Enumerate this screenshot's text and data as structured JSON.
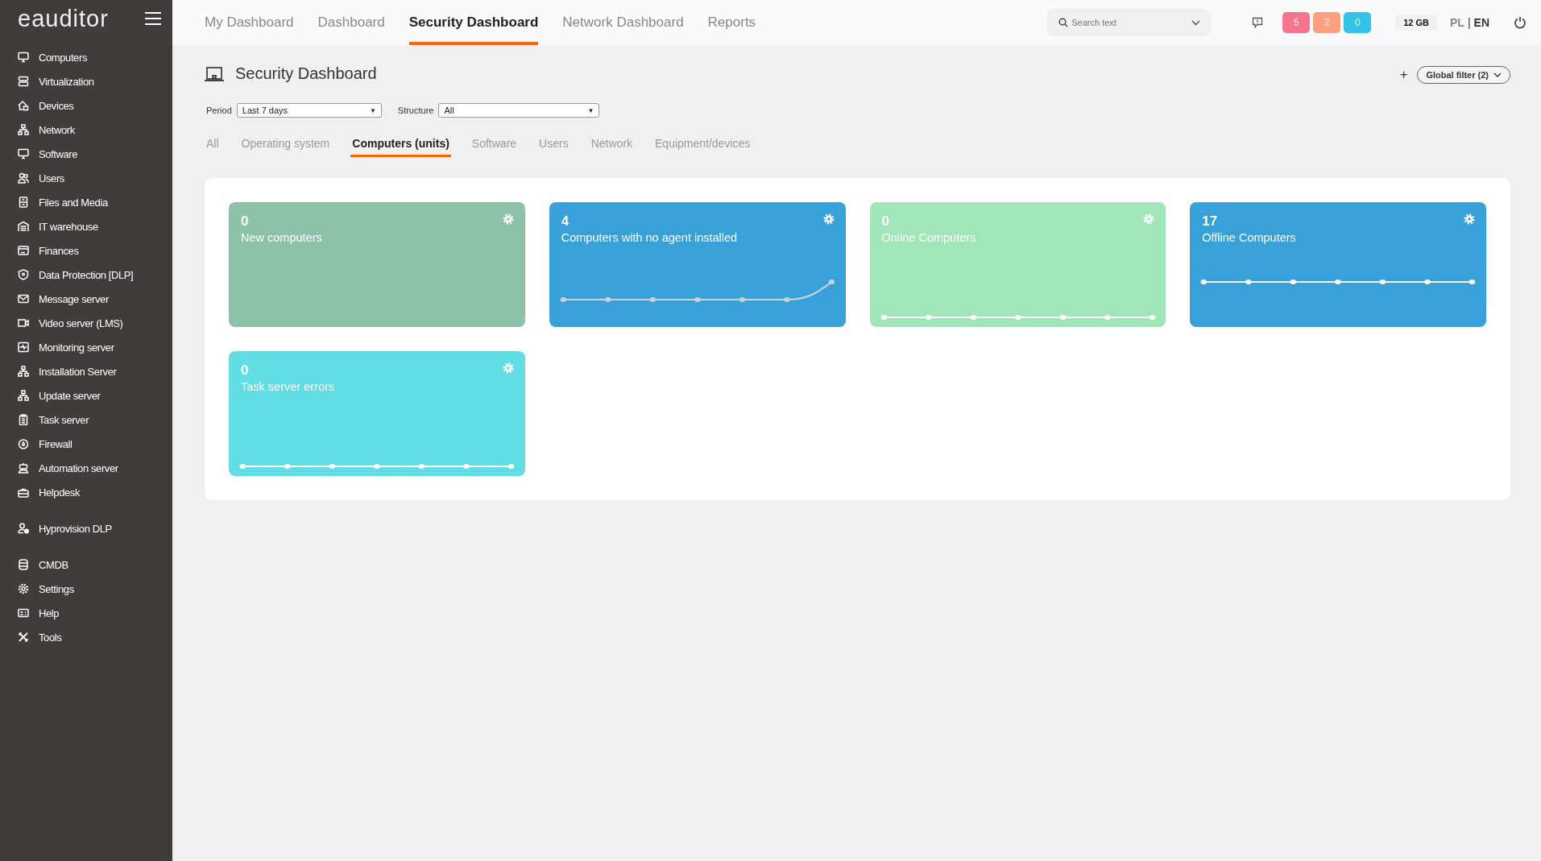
{
  "sidebar": {
    "logo": "eauditor",
    "sections": [
      {
        "items": [
          "Computers",
          "Virtualization",
          "Devices",
          "Network",
          "Software",
          "Users",
          "Files and Media",
          "IT warehouse",
          "Finances",
          "Data Protection [DLP]",
          "Message server",
          "Video server (LMS)",
          "Monitoring server",
          "Installation Server",
          "Update server",
          "Task server",
          "Firewall",
          "Automation server",
          "Helpdesk"
        ]
      },
      {
        "items": [
          "Hyprovision DLP"
        ]
      },
      {
        "items": [
          "CMDB",
          "Settings",
          "Help",
          "Tools"
        ]
      }
    ]
  },
  "top_nav": [
    {
      "label": "My Dashboard",
      "selected": false
    },
    {
      "label": "Dashboard",
      "selected": false
    },
    {
      "label": "Security Dashboard",
      "selected": true
    },
    {
      "label": "Network Dashboard",
      "selected": false
    },
    {
      "label": "Reports",
      "selected": false
    }
  ],
  "search": {
    "placeholder": "Search text"
  },
  "alert_counts": [
    {
      "text": "5",
      "color": "#f7748f"
    },
    {
      "text": "2",
      "color": "#fca07f"
    },
    {
      "text": "0",
      "color": "#32c3e6"
    }
  ],
  "storage": "12 GB",
  "languages": [
    {
      "label": "PL",
      "selected": false
    },
    {
      "label": "EN",
      "selected": true
    }
  ],
  "language_separator": "|",
  "page_title": "Security Dashboard",
  "global_filter": {
    "add": "+",
    "label": "Global filter (2)"
  },
  "filters": [
    {
      "label": "Period",
      "value": "Last 7 days"
    },
    {
      "label": "Structure",
      "value": "All"
    }
  ],
  "caret": "▼",
  "sub_tabs": [
    {
      "label": "All",
      "selected": false
    },
    {
      "label": "Operating system",
      "selected": false
    },
    {
      "label": "Computers (units)",
      "selected": true
    },
    {
      "label": "Software",
      "selected": false
    },
    {
      "label": "Users",
      "selected": false
    },
    {
      "label": "Network",
      "selected": false
    },
    {
      "label": "Equipment/devices",
      "selected": false
    }
  ],
  "cards": [
    {
      "value": "0",
      "title": "New computers",
      "color": "#8dc1a8",
      "kind": "empty"
    },
    {
      "value": "4",
      "title": "Computers with no agent installed",
      "color": "#38a1da",
      "kind": "rising"
    },
    {
      "value": "0",
      "title": "Online Computers",
      "color": "#a1e6b9",
      "kind": "flat-bottom"
    },
    {
      "value": "17",
      "title": "Offline Computers",
      "color": "#38a1da",
      "kind": "flat-middle"
    },
    {
      "value": "0",
      "title": "Task server errors",
      "color": "#62dde3",
      "kind": "flat-bottom"
    }
  ]
}
